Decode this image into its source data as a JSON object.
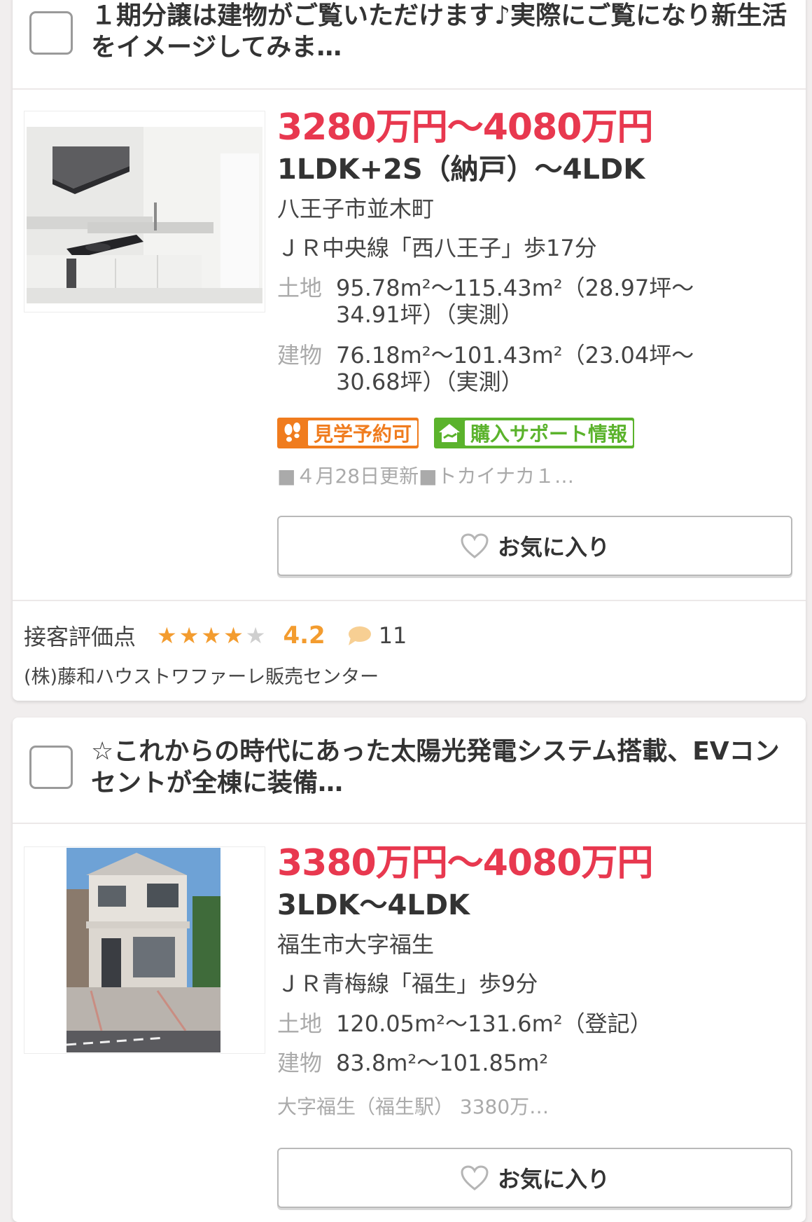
{
  "listings": [
    {
      "catch_copy": "１期分譲は建物がご覧いただけます♪実際にご覧になり新生活をイメージしてみま…",
      "price": "3280万円〜4080万円",
      "layout": "1LDK+2S（納戸）〜4LDK",
      "address": "八王子市並木町",
      "access": "ＪＲ中央線「西八王子」歩17分",
      "land_label": "土地",
      "land_value": "95.78m²〜115.43m²（28.97坪〜34.91坪）（実測）",
      "building_label": "建物",
      "building_value": "76.18m²〜101.43m²（23.04坪〜30.68坪）（実測）",
      "tags": [
        "見学予約可",
        "購入サポート情報"
      ],
      "note": "■４月28日更新■トカイナカ１…",
      "favorite_label": "お気に入り",
      "rating_label": "接客評価点",
      "rating_value": 4.2,
      "rating_score": "4.2",
      "review_count": "11",
      "company": "(株)藤和ハウストワファーレ販売センター"
    },
    {
      "catch_copy": "☆これからの時代にあった太陽光発電システム搭載、EVコンセントが全棟に装備…",
      "price": "3380万円〜4080万円",
      "layout": "3LDK〜4LDK",
      "address": "福生市大字福生",
      "access": "ＪＲ青梅線「福生」歩9分",
      "land_label": "土地",
      "land_value": "120.05m²〜131.6m²（登記）",
      "building_label": "建物",
      "building_value": "83.8m²〜101.85m²",
      "note": "大字福生（福生駅） 3380万…",
      "favorite_label": "お気に入り"
    }
  ],
  "colors": {
    "price": "#e8384f",
    "star": "#f39c2f",
    "tag_orange": "#f07c1e",
    "tag_green": "#5bb32c"
  },
  "icons": [
    "checkbox-icon",
    "footprints-icon",
    "house-support-icon",
    "heart-icon",
    "star-icon",
    "speech-bubble-icon"
  ]
}
